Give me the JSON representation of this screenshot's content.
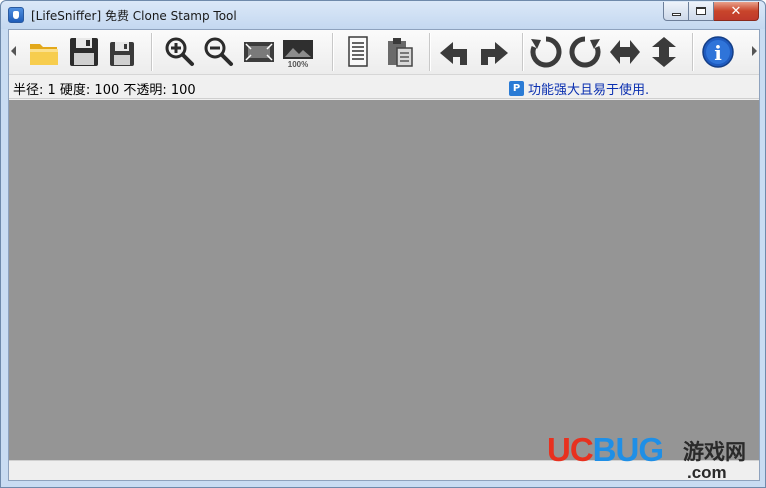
{
  "window": {
    "title": "[LifeSniffer]  免费 Clone Stamp Tool",
    "icon": "app-icon",
    "caption_buttons": [
      {
        "name": "minimize-button",
        "icon": "minimize-icon"
      },
      {
        "name": "maximize-button",
        "icon": "maximize-icon"
      },
      {
        "name": "close-button",
        "icon": "close-icon",
        "label": "✕"
      }
    ]
  },
  "toolbar": {
    "scroll_left_icon": "triangle-left-icon",
    "scroll_right_icon": "triangle-right-icon",
    "buttons": [
      {
        "name": "open-button",
        "icon": "folder-open-icon"
      },
      {
        "name": "save-button",
        "icon": "floppy-disk-icon"
      },
      {
        "name": "save-as-button",
        "icon": "floppy-disk-small-icon"
      },
      {
        "name": "zoom-in-button",
        "icon": "zoom-in-icon"
      },
      {
        "name": "zoom-out-button",
        "icon": "zoom-out-icon"
      },
      {
        "name": "fit-window-button",
        "icon": "fit-to-window-icon"
      },
      {
        "name": "actual-size-button",
        "icon": "actual-size-icon",
        "label": "100%"
      },
      {
        "name": "copy-button",
        "icon": "document-icon"
      },
      {
        "name": "paste-button",
        "icon": "clipboard-icon"
      },
      {
        "name": "undo-button",
        "icon": "undo-arrow-icon"
      },
      {
        "name": "redo-button",
        "icon": "redo-arrow-icon"
      },
      {
        "name": "rotate-left-button",
        "icon": "rotate-ccw-icon"
      },
      {
        "name": "rotate-right-button",
        "icon": "rotate-cw-icon"
      },
      {
        "name": "flip-horizontal-button",
        "icon": "flip-horizontal-icon"
      },
      {
        "name": "flip-vertical-button",
        "icon": "flip-vertical-icon"
      },
      {
        "name": "about-button",
        "icon": "info-icon",
        "label": "i"
      }
    ]
  },
  "infobar": {
    "brush_settings": "半径: 1 硬度: 100 不透明: 100",
    "promo_text": "功能强大且易于使用.",
    "promo_icon": "app-badge-icon",
    "promo_icon_label": "P"
  },
  "watermark": {
    "logo_uc": "UC",
    "logo_bug": "BUG",
    "logo_cn": "游戏网",
    "logo_domain": ".com"
  },
  "colors": {
    "canvas_background": "#959595",
    "promo_link": "#0a2fb0",
    "close_button": "#c9452b"
  }
}
